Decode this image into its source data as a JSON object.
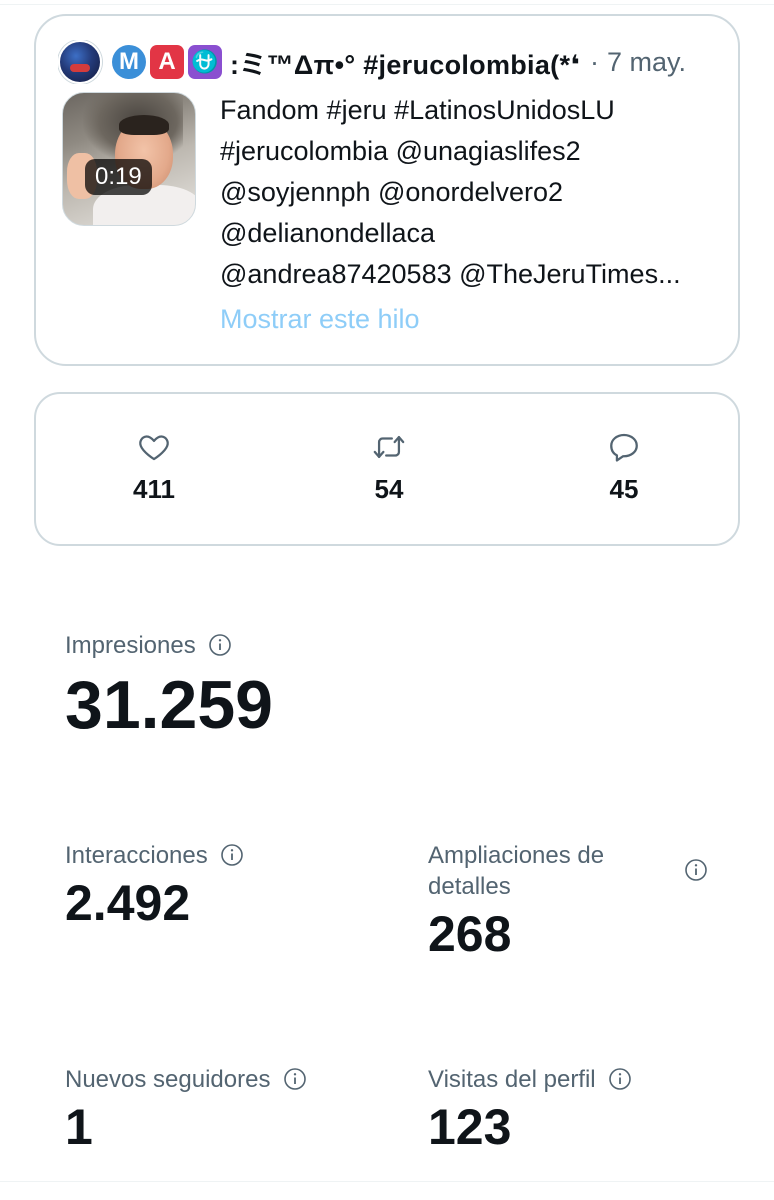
{
  "tweet": {
    "header_name": ":ミ™Δπ•° #jerucolombia(*❛",
    "dot": "·",
    "date": "7 may.",
    "badges": [
      "M",
      "A",
      "⛎"
    ],
    "video_duration": "0:19",
    "text_lines": [
      "Fandom #jeru #LatinosUnidosLU",
      "#jerucolombia @unagiaslifes2",
      "@soyjennph @onordelvero2",
      "@delianondellaca",
      "@andrea87420583 @TheJeruTimes..."
    ],
    "show_thread_label": "Mostrar este hilo"
  },
  "engagement": {
    "likes": "411",
    "retweets": "54",
    "replies": "45"
  },
  "metrics": {
    "impressions": {
      "label": "Impresiones",
      "value": "31.259"
    },
    "interactions": {
      "label": "Interacciones",
      "value": "2.492"
    },
    "detail_expands": {
      "label_line1": "Ampliaciones de",
      "label_line2": "detalles",
      "value": "268"
    },
    "new_followers": {
      "label": "Nuevos seguidores",
      "value": "1"
    },
    "profile_visits": {
      "label": "Visitas del perfil",
      "value": "123"
    }
  },
  "colors": {
    "text": "#0f1419",
    "secondary": "#536471",
    "link_faded": "#8ecdf8",
    "border": "#cfd9de"
  }
}
